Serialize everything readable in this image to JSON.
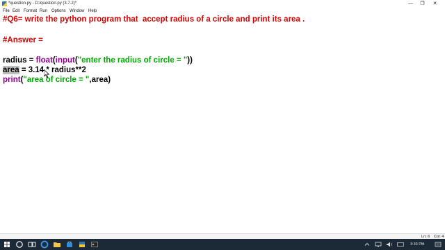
{
  "window": {
    "title": "*question.py - D:/question.py (3.7.2)*",
    "minimize_glyph": "—",
    "maximize_glyph": "❐",
    "close_glyph": "✕"
  },
  "menubar": {
    "items": [
      "File",
      "Edit",
      "Format",
      "Run",
      "Options",
      "Window",
      "Help"
    ]
  },
  "editor": {
    "comment_line": "#Q6= write the python program that  accept radius of a circle and print its area .",
    "answer_line": "#Answer =",
    "line1": {
      "var": "radius",
      "op": " = ",
      "fn1": "float",
      "p1": "(",
      "fn2": "input",
      "p2": "(",
      "str": "\"enter the radius of circle = \"",
      "tail": "))"
    },
    "line2": {
      "var": "area",
      "rest": " = 3.14 * radius**2"
    },
    "line3": {
      "fn": "print",
      "p": "(",
      "str": "\"area of circle = \"",
      "tail": ",area)"
    }
  },
  "statusbar": {
    "line": "Ln: 6",
    "col": "Col: 4"
  },
  "taskbar": {
    "time": "3:33 PM",
    "colors": {
      "background": "#1c2a38",
      "accent": "#8ab4e8"
    }
  },
  "colors": {
    "comment": "#dd0000",
    "builtin": "#900090",
    "string": "#00aa00",
    "selection": "#bfbfbf"
  }
}
